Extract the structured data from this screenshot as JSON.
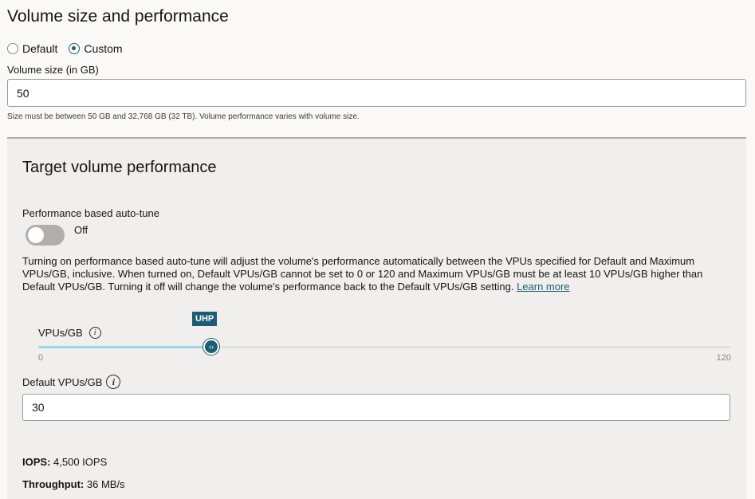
{
  "section": {
    "title": "Volume size and performance"
  },
  "radios": [
    {
      "label": "Default",
      "selected": false
    },
    {
      "label": "Custom",
      "selected": true
    }
  ],
  "volume_size": {
    "label": "Volume size (in GB)",
    "value": "50",
    "hint": "Size must be between 50 GB and 32,768 GB (32 TB). Volume performance varies with volume size."
  },
  "target": {
    "title": "Target volume performance",
    "autotune_label": "Performance based auto-tune",
    "autotune_state": "Off",
    "description": "Turning on performance based auto-tune will adjust the volume's performance automatically between the VPUs specified for Default and Maximum VPUs/GB, inclusive. When turned on, Default VPUs/GB cannot be set to 0 or 120 and Maximum VPUs/GB must be at least 10 VPUs/GB higher than Default VPUs/GB. Turning it off will change the volume's performance back to the Default VPUs/GB setting.",
    "learn_more": "Learn more"
  },
  "slider": {
    "label": "VPUs/GB",
    "badge": "UHP",
    "min": "0",
    "max": "120",
    "value": 30,
    "thumb_icon": "‹›"
  },
  "default_vpus": {
    "label": "Default VPUs/GB",
    "value": "30"
  },
  "stats": {
    "iops_label": "IOPS:",
    "iops_value": "4,500 IOPS",
    "throughput_label": "Throughput:",
    "throughput_value": "36 MB/s"
  },
  "info_icon_glyph": "i",
  "colors": {
    "accent": "#1d5c74",
    "slider_fill": "#9fd7e9",
    "panel_bg": "#f1efed"
  }
}
